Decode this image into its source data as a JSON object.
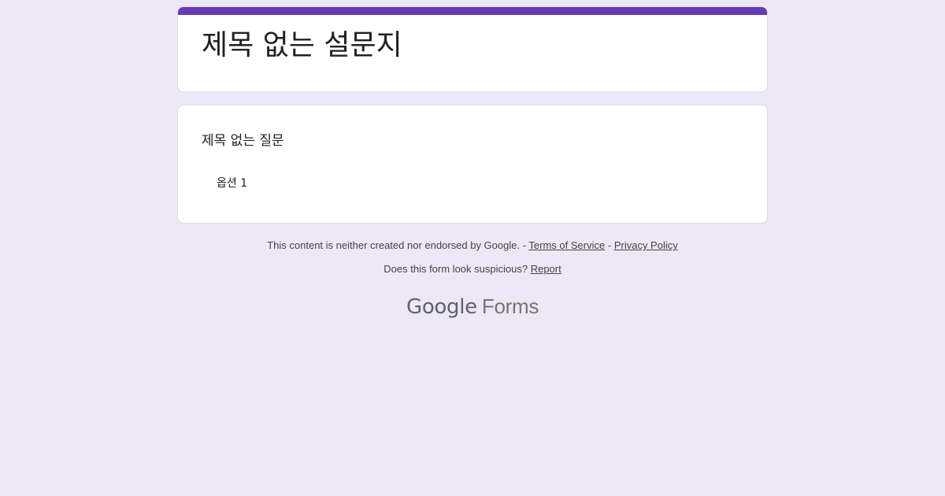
{
  "form": {
    "title": "제목 없는 설문지",
    "accent_color": "#673ab7",
    "background_color": "#ede7f6"
  },
  "question": {
    "title": "제목 없는 질문",
    "options": [
      "옵션 1"
    ]
  },
  "footer": {
    "disclaimer": "This content is neither created nor endorsed by Google. -",
    "separator": "-",
    "terms_link": "Terms of Service",
    "privacy_link": "Privacy Policy",
    "suspicious_text": "Does this form look suspicious?",
    "report_link": "Report"
  },
  "logo": {
    "brand": "Google",
    "product": "Forms"
  }
}
